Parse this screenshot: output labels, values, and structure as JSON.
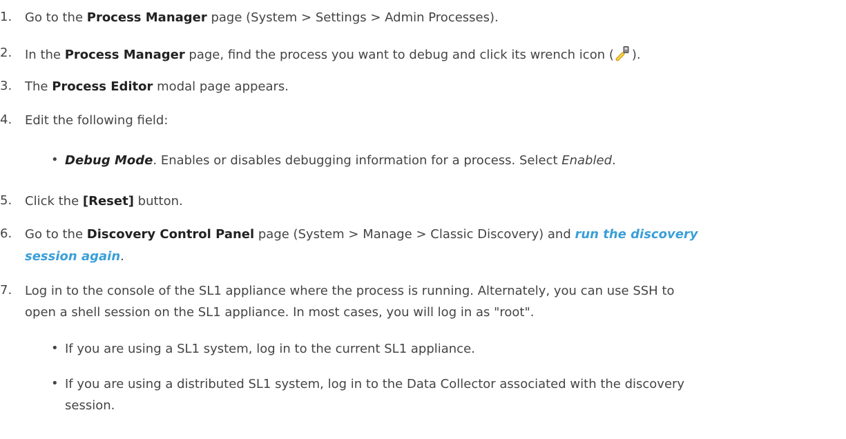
{
  "steps": [
    {
      "n": "1.",
      "a": "Go to the ",
      "b": "Process Manager",
      "c": " page (System > Settings > Admin Processes)."
    },
    {
      "n": "2.",
      "a": "In the ",
      "b": "Process Manager",
      "c": " page, find the process you want to debug and click its wrench icon (",
      "d": ")."
    },
    {
      "n": "3.",
      "a": "The ",
      "b": "Process Editor",
      "c": " modal page appears."
    },
    {
      "n": "4.",
      "a": "Edit the following field:"
    },
    {
      "n": "5.",
      "a": "Click the ",
      "b": "[Reset]",
      "c": " button."
    },
    {
      "n": "6.",
      "a": "Go to the ",
      "b": "Discovery Control Panel",
      "c": " page (System > Manage > Classic Discovery) and ",
      "link1": "run the discovery",
      "link2": "session again",
      "e": "."
    },
    {
      "n": "7.",
      "l1": "Log in to the console of the SL1 appliance where the process is running. Alternately, you can use SSH to",
      "l2": "open a shell session on the SL1 appliance. In most cases, you will log in as \"root\"."
    }
  ],
  "field": {
    "name": "Debug Mode",
    "desc": ". Enables or disables debugging information for a process. Select ",
    "value": "Enabled",
    "end": "."
  },
  "sub_bullets": [
    {
      "l1": "If you are using a SL1 system, log in to the current SL1 appliance."
    },
    {
      "l1": "If you are using a distributed SL1 system, log in to the Data Collector associated with the discovery",
      "l2": "session."
    }
  ],
  "bullet_char": "•",
  "icons": {
    "wrench": "wrench-icon"
  }
}
